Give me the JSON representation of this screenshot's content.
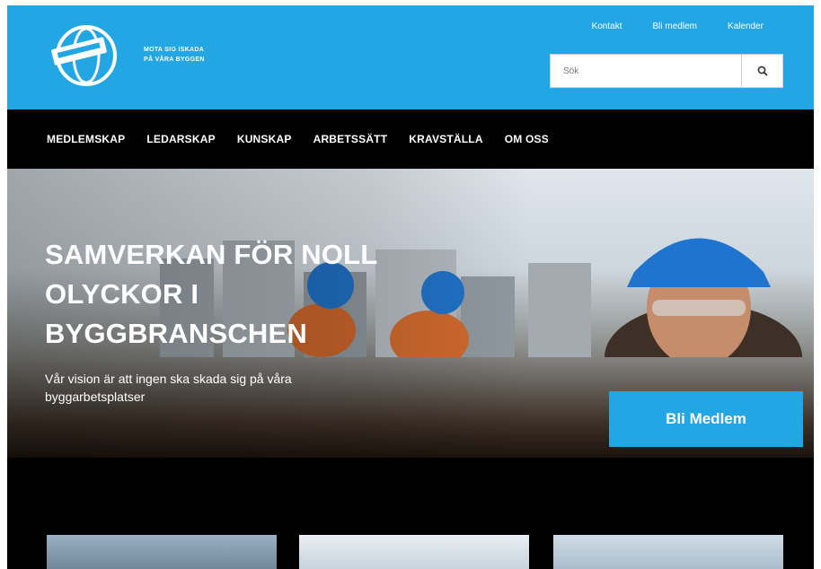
{
  "header": {
    "tagline_line1": "MOTA SIG ISKADA",
    "tagline_line2": "PÅ VÅRA BYGGEN",
    "top_links": [
      "Kontakt",
      "Bli medlem",
      "Kalender"
    ],
    "search": {
      "placeholder": "Sök",
      "icon": "search-icon"
    },
    "colors": {
      "brand": "#22a7e4",
      "nav": "#000000"
    }
  },
  "nav": {
    "items": [
      "MEDLEMSKAP",
      "LEDARSKAP",
      "KUNSKAP",
      "ARBETSSÄTT",
      "KRAVSTÄLLA",
      "OM OSS"
    ]
  },
  "hero": {
    "title": "SAMVERKAN FÖR NOLL OLYCKOR I BYGGBRANSCHEN",
    "subtitle": "Vår vision är att ingen ska skada sig på våra byggarbetsplatser",
    "cta_label": "Bli Medlem"
  },
  "cards": [
    {
      "name": "card-image-1"
    },
    {
      "name": "card-image-2"
    },
    {
      "name": "card-image-3"
    }
  ]
}
